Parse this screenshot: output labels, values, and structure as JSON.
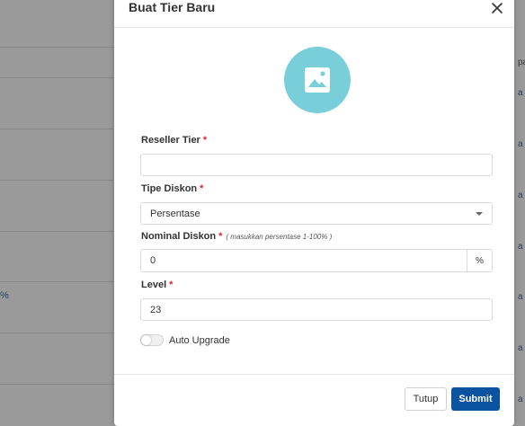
{
  "background": {
    "left_text": "%",
    "right_header_fragment": "pa",
    "right_links": [
      "a",
      "a",
      "a",
      "a",
      "a",
      "a",
      "a"
    ]
  },
  "modal": {
    "title": "Buat Tier Baru",
    "close_icon": "close-icon",
    "avatar_icon": "image-icon",
    "fields": {
      "reseller_tier": {
        "label": "Reseller Tier",
        "required": "*",
        "value": "",
        "placeholder": ""
      },
      "tipe_diskon": {
        "label": "Tipe Diskon",
        "required": "*",
        "value": "Persentase"
      },
      "nominal_diskon": {
        "label": "Nominal Diskon",
        "required": "*",
        "hint": "( masukkan persentase 1-100% )",
        "value": "0",
        "suffix": "%"
      },
      "level": {
        "label": "Level",
        "required": "*",
        "value": "23"
      }
    },
    "auto_upgrade": {
      "label": "Auto Upgrade",
      "enabled": false
    },
    "buttons": {
      "tutup": "Tutup",
      "submit": "Submit"
    }
  },
  "colors": {
    "primary": "#0b52a0",
    "avatar_bg": "#79cfd9",
    "required": "#e02424",
    "overlay": "#9a9a9a"
  }
}
